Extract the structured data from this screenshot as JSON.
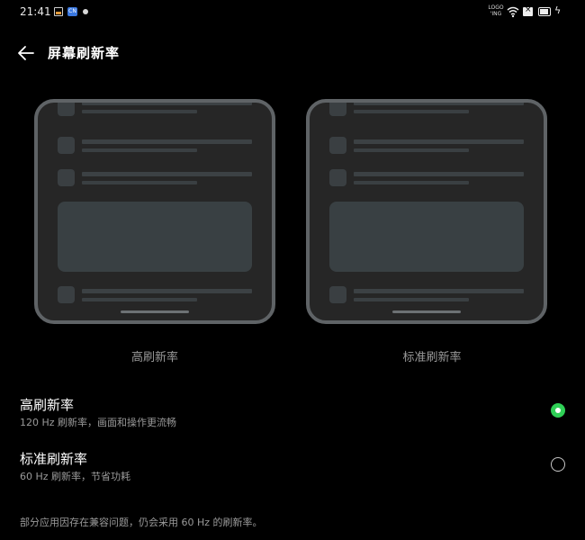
{
  "status_bar": {
    "time": "21:41",
    "app_badge": "CN",
    "label_icon_text": "LOGO\n'ING",
    "icons": [
      "gallery-icon",
      "app-icon",
      "notification-dot-icon",
      "wifi-icon",
      "close-box-icon",
      "battery-icon",
      "charging-bolt-icon"
    ]
  },
  "header": {
    "back_icon": "arrow-left-icon",
    "title": "屏幕刷新率"
  },
  "previews": [
    {
      "label": "高刷新率"
    },
    {
      "label": "标准刷新率"
    }
  ],
  "options": [
    {
      "title": "高刷新率",
      "description": "120 Hz 刷新率，画面和操作更流畅",
      "selected": true
    },
    {
      "title": "标准刷新率",
      "description": "60 Hz 刷新率，节省功耗",
      "selected": false
    }
  ],
  "footnote": "部分应用因存在兼容问题，仍会采用 60 Hz 的刷新率。",
  "colors": {
    "background": "#000000",
    "accent_green": "#2fd056",
    "frame_border": "#5f6366",
    "secondary_text": "#9a9a9a"
  }
}
